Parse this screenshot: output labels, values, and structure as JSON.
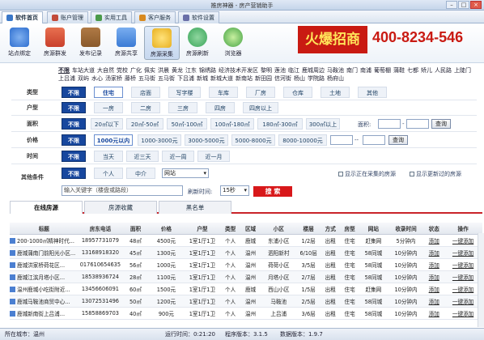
{
  "window": {
    "title": "推房神器 - 房产营销助手"
  },
  "tabs": [
    {
      "label": "软件首页"
    },
    {
      "label": "账户管理"
    },
    {
      "label": "实用工具"
    },
    {
      "label": "客户服务"
    },
    {
      "label": "软件设置"
    }
  ],
  "toolbar": [
    {
      "label": "站点绑定",
      "icon": "network-icon",
      "color": "#2f6fd0"
    },
    {
      "label": "房源群发",
      "icon": "house-icon",
      "color": "#c9402c"
    },
    {
      "label": "发布记录",
      "icon": "notebook-icon",
      "color": "#8a5a2b"
    },
    {
      "label": "房源共享",
      "icon": "share-icon",
      "color": "#3a7bd5"
    },
    {
      "label": "房源采集",
      "icon": "magnifier-icon",
      "color": "#e8b020"
    },
    {
      "label": "房源刷新",
      "icon": "refresh-icon",
      "color": "#3aa55a"
    },
    {
      "label": "浏览器",
      "icon": "browser-icon",
      "color": "#44a244"
    }
  ],
  "banner": {
    "ad_text": "火爆招商",
    "phone": "400-8234-546"
  },
  "cities": [
    "不限",
    "车站大道",
    "大自然",
    "党校",
    "广化",
    "佩实",
    "洪晨",
    "黄龙",
    "江东",
    "锦绣路",
    "经济技术开发区",
    "黎明",
    "莲池",
    "临江",
    "鹿城周边",
    "马鞍池",
    "南门",
    "南浦",
    "葡萄棚",
    "蒲鞋",
    "七都",
    "矫儿",
    "人民路",
    "上陡门",
    "上吕浦",
    "双屿",
    "水心",
    "汤家桥",
    "藤桥",
    "五马街",
    "五马街",
    "下吕浦",
    "新城",
    "新城大道",
    "新南站",
    "新田园",
    "信河街",
    "杨山",
    "学院路",
    "杨府山"
  ],
  "filters": {
    "type": {
      "label": "类型",
      "options": [
        "不限",
        "住宅",
        "店面",
        "写字楼",
        "车库",
        "厂房",
        "仓库",
        "土地",
        "其他"
      ]
    },
    "layout": {
      "label": "户型",
      "options": [
        "不限",
        "一房",
        "二房",
        "三房",
        "四房",
        "四房以上"
      ]
    },
    "area": {
      "label": "面积",
      "options": [
        "不限",
        "20㎡以下",
        "20㎡-50㎡",
        "50㎡-100㎡",
        "100㎡-180㎡",
        "180㎡-300㎡",
        "300㎡以上"
      ],
      "custom_label": "面积:",
      "confirm": "查询"
    },
    "price": {
      "label": "价格",
      "options": [
        "不限",
        "1000元以内",
        "1000-3000元",
        "3000-5000元",
        "5000-8000元",
        "8000-10000元"
      ],
      "confirm": "查询",
      "dash": "--"
    },
    "time": {
      "label": "时间",
      "options": [
        "不限",
        "当天",
        "近三天",
        "近一周",
        "近一月"
      ]
    },
    "other": {
      "label": "其他条件",
      "options": [
        "不限",
        "个人",
        "中介"
      ],
      "site_label": "网站"
    },
    "chk_collecting": "显示正在采集的房源",
    "chk_updated": "显示更新过的房源"
  },
  "search": {
    "placeholder": "输入关键字（楼盘或路段）",
    "refresh_label": "刷新时间:",
    "refresh_value": "15秒",
    "button": "搜 索"
  },
  "subtabs": [
    "在线房源",
    "房源收藏",
    "黑名单"
  ],
  "table": {
    "headers": [
      "标题",
      "房东电话",
      "面积",
      "价格",
      "户型",
      "类型",
      "区域",
      "小区",
      "楼层",
      "方式",
      "房型",
      "网站",
      "收录时间",
      "状态",
      "操作"
    ],
    "rows": [
      [
        "200-1000㎡精神时代...",
        "18957731079",
        "48㎡",
        "4500元",
        "1室1厅1卫",
        "个人",
        "鹿城",
        "东浦小区",
        "1/2层",
        "出租",
        "住宅",
        "赶集网",
        "5分钟内",
        "添加",
        "一键添加"
      ],
      [
        "鹿城蒲南门前阳光小区...",
        "13168918320",
        "45㎡",
        "1300元",
        "1室1厅1卫",
        "个人",
        "温州",
        "泗阳新村",
        "6/10层",
        "出租",
        "住宅",
        "58同城",
        "10分钟内",
        "添加",
        "一键添加"
      ],
      [
        "鹿城洪家桥荷花区...",
        "017610654635",
        "56㎡",
        "1000元",
        "1室1厅1卫",
        "个人",
        "温州",
        "荷荷小区",
        "3/5层",
        "出租",
        "住宅",
        "58同城",
        "10分钟内",
        "添加",
        "一键添加"
      ],
      [
        "鹿城江滨月塔小区...",
        "18538936724",
        "28㎡",
        "1100元",
        "1室1厅1卫",
        "个人",
        "温州",
        "月塔小区",
        "2/7层",
        "出租",
        "住宅",
        "58同城",
        "10分钟内",
        "添加",
        "一键添加"
      ],
      [
        "温州鹿城小吃街附近...",
        "13456606091",
        "60㎡",
        "1500元",
        "1室1厅1卫",
        "个人",
        "鹿城",
        "西山小区",
        "1/5层",
        "出租",
        "住宅",
        "赶集网",
        "10分钟内",
        "添加",
        "一键添加"
      ],
      [
        "鹿城马鞍池商贸中心...",
        "13072531496",
        "50㎡",
        "1200元",
        "1室1厅1卫",
        "个人",
        "温州",
        "马鞍池",
        "2/5层",
        "出租",
        "住宅",
        "58同城",
        "10分钟内",
        "添加",
        "一键添加"
      ],
      [
        "鹿城新南街上吕浦...",
        "15858869703",
        "40㎡",
        "900元",
        "1室1厅1卫",
        "个人",
        "温州",
        "上吕浦",
        "3/6层",
        "出租",
        "住宅",
        "58同城",
        "10分钟内",
        "添加",
        "一键添加"
      ]
    ]
  },
  "status": {
    "city": "所在城市：温州",
    "runtime": "运行时间：0:21:20",
    "app_version": "程序版本：3.1.5",
    "db_version": "数据版本：1.9.7"
  }
}
